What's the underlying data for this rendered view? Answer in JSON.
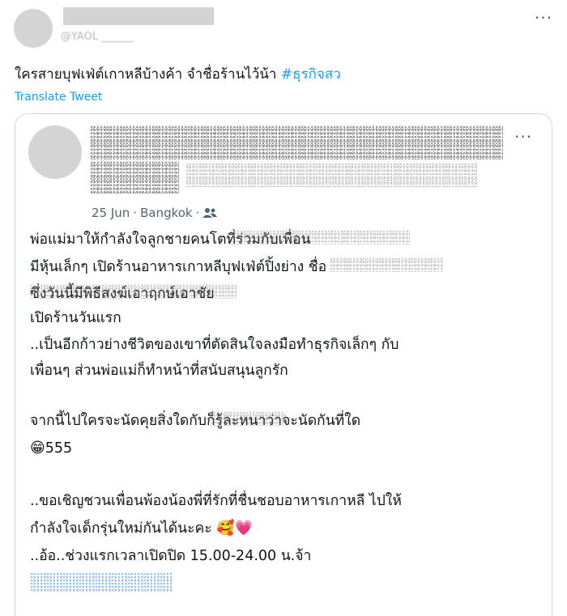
{
  "tweet": {
    "more_icon": "···",
    "text": "ใครสายบุฟเฟ่ต์เกาหลีบ้างค้า จำชื่อร้านไว้น้า ",
    "hashtag": "#ธุรกิจสว",
    "translate_label": "Translate Tweet"
  },
  "quoted": {
    "more_icon": "···",
    "date": "25 Jun",
    "separator": "·",
    "location": "Bangkok",
    "audience_icon": "friends-icon",
    "lines": {
      "l1a": "พ่อแม่มาให้กำลังใจลูกชายคนโต",
      "l1b": "ที่ร่วมกับเพื่อน",
      "l2": "มีหุ้นเล็กๆ เปิดร้านอาหารเกาหลีบุฟเฟ่ต์ปิ้งย่าง ชื่อ",
      "l3": "ซึ่งวันนี้มีพิธีสงฆ์เอาฤกษ์เอาชัย",
      "l4": "เปิดร้านวันแรก",
      "l5": "..เป็นอีกก้าวย่างชีวิตของเขาที่ตัดสินใจลงมือทำธุรกิจเล็กๆ กับ",
      "l6": "เพื่อนๆ ส่วนพ่อแม่ก็ทำหน้าที่สนับสนุนลูกรัก",
      "l7a": "จากนี้ไปใครจะนัดคุยสิ่งใดกับ",
      "l7b": "ก็รู้ละหนาว่าจะนัดกันที่ใด",
      "l8": "555",
      "l9": "..ขอเชิญชวนเพื่อนพ้องน้องพี่ที่รักที่ชื่นชอบอาหารเกาหลี ไปให้",
      "l10": "กำลังใจเด็กรุ่นใหม่กันได้นะคะ",
      "l11": "..อ้อ..ช่วงแรกเวลาเปิดปิด 15.00-24.00 น.จ้า"
    },
    "emojis": {
      "grin": "😁",
      "hearts_face": "🥰",
      "heart": "💗"
    }
  }
}
